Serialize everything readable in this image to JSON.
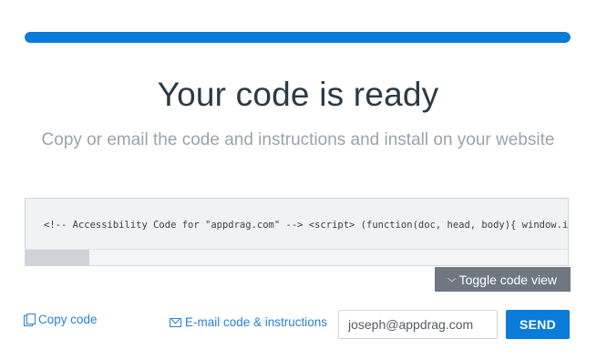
{
  "progress": {
    "value": 1.0
  },
  "title": "Your code is ready",
  "subtitle": "Copy or email the code and instructions and install on your website",
  "code": {
    "snippet": "<!-- Accessibility Code for \"appdrag.com\" --> <script> (function(doc, head, body){ window.interdeal = { \"sitekey\": \"...\" }"
  },
  "toggle": {
    "label": "Toggle code view",
    "icon": "chevron-down-icon"
  },
  "actions": {
    "copy_label": "Copy code",
    "copy_icon": "copy-icon",
    "email_label": "E-mail code & instructions",
    "email_icon": "mail-icon",
    "email_value": "joseph@appdrag.com",
    "send_label": "SEND"
  },
  "colors": {
    "accent": "#0a7bd8",
    "toggle_bg": "#6f7780",
    "link": "#2a7fd3"
  }
}
